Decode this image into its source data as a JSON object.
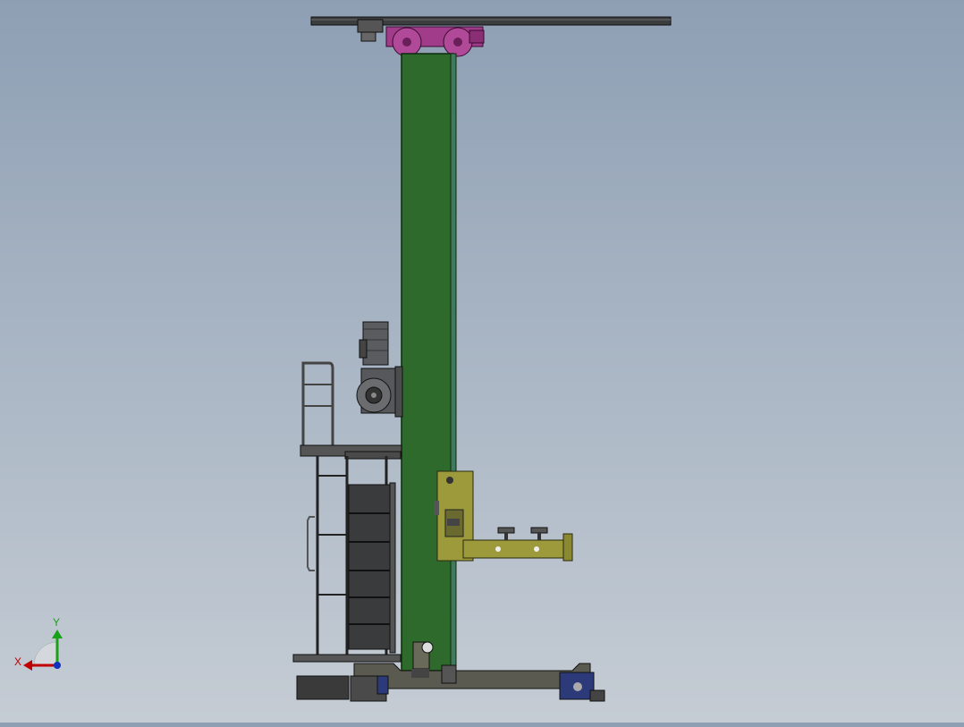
{
  "view": {
    "background_top": "#8e9fb4",
    "background_bottom": "#c5ccd4"
  },
  "colors": {
    "column": "#2e6a2c",
    "column_edge": "#0f2a0e",
    "trolley": "#a03c8a",
    "arm": "#9c9a3a",
    "steel": "#4a4c4e",
    "motor": "#5a5c60",
    "base_blue": "#2c3a7a",
    "axis_x": "#c00000",
    "axis_y": "#1aa01a",
    "axis_z": "#1030c0"
  },
  "triad": {
    "x_label": "X",
    "y_label": "Y"
  },
  "components": [
    "top-rail-beam",
    "trolley",
    "vertical-column",
    "drive-motor",
    "winch-drum",
    "operator-platform",
    "handrail",
    "ladder",
    "counterweight-stack",
    "carriage",
    "horizontal-arm",
    "base-frame",
    "base-wheels"
  ]
}
